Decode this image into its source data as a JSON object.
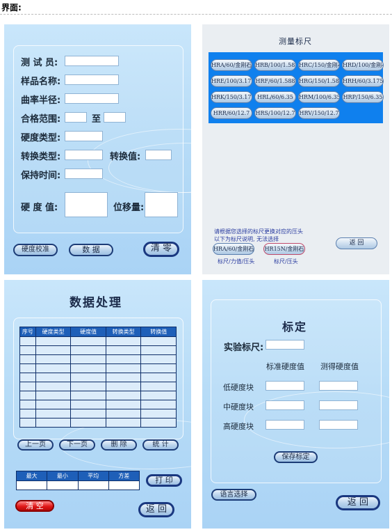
{
  "header": {
    "title": "界面:"
  },
  "panel1": {
    "labels": {
      "tester": "测 试 员:",
      "sample_name": "样品名称:",
      "curvature": "曲率半径:",
      "range": "合格范围:",
      "to": "至",
      "hardness_type": "硬度类型:",
      "convert_type": "转换类型:",
      "convert_value": "转换值:",
      "hold_time": "保持时间:",
      "hardness_value": "硬 度 值:",
      "displacement": "位移量:"
    },
    "buttons": {
      "calibrate": "硬度校准",
      "data": "数 据",
      "clear": "清 零"
    }
  },
  "panel2": {
    "title": "测量标尺",
    "scales": [
      "HRA/60/金刚石",
      "HRB/100/1.588",
      "HRC/150/金刚石",
      "HRD/100/金刚石",
      "HRE/100/3.175",
      "HRF/60/1.588",
      "HRG/150/1.588",
      "HRH/60/3.175",
      "HRK/150/3.175",
      "HRL/60/6.35",
      "HRM/100/6.35",
      "HRP/150/6.35",
      "HRR/60/12.7",
      "HRS/100/12.7",
      "HRV/150/12.7"
    ],
    "hint_line1": "请根据您选择的标尺更换对应的压头",
    "hint_line2": "以下为标尺说明, 无法选择",
    "selected_scale": "HRA/60/金刚石",
    "selected_scale2": "HR15N/金刚石",
    "caption1": "标尺/力值/压头",
    "caption2": "标尺/压头",
    "back": "返 回"
  },
  "panel3": {
    "title": "数据处理",
    "columns": [
      "序号",
      "硬度类型",
      "硬度值",
      "转换类型",
      "转换值"
    ],
    "row_count": 10,
    "buttons": {
      "prev": "上一页",
      "next": "下一页",
      "delete": "删 除",
      "stats": "统 计",
      "print": "打 印",
      "clear": "清 空",
      "back": "返 回"
    },
    "stats_columns": [
      "最大",
      "最小",
      "平均",
      "方差"
    ]
  },
  "panel4": {
    "title": "标定",
    "exp_scale": "实验标尺:",
    "std_header": "标准硬度值",
    "meas_header": "测得硬度值",
    "rows": [
      "低硬度块",
      "中硬度块",
      "高硬度块"
    ],
    "save": "保存标定",
    "lang": "语言选择",
    "back": "返 回"
  },
  "colors": {
    "panel": "#b7dcf7",
    "accent_blue": "#0f80ee",
    "table_header": "#1e5fb8",
    "button_border": "#1c3c77",
    "clear_red": "#e01818"
  }
}
